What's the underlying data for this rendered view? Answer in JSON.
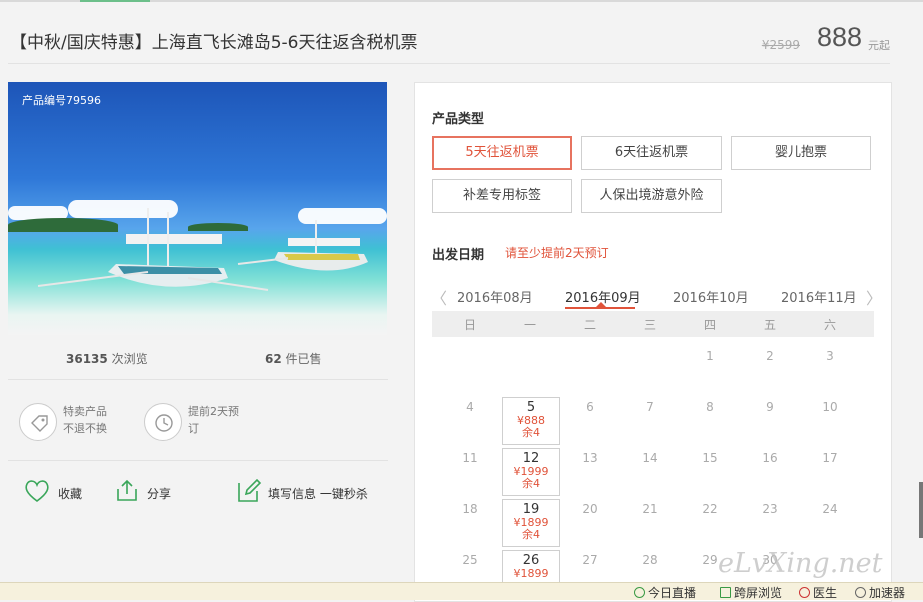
{
  "header": {
    "title": "【中秋/国庆特惠】上海直飞长滩岛5-6天往返含税机票",
    "old_price": "¥2599",
    "price": "888",
    "price_unit": "元起"
  },
  "gallery": {
    "product_id": "产品编号79596"
  },
  "stats": {
    "views_count": "36135",
    "views_label": "次浏览",
    "sold_count": "62",
    "sold_label": "件已售"
  },
  "features": [
    {
      "icon": "tag-icon",
      "line1": "特卖产品",
      "line2": "不退不换"
    },
    {
      "icon": "clock-icon",
      "line1": "提前2天预",
      "line2": "订"
    }
  ],
  "actions": {
    "favorite": "收藏",
    "share": "分享",
    "quick_fill": "填写信息 一键秒杀"
  },
  "booking": {
    "product_type_label": "产品类型",
    "options": [
      "5天往返机票",
      "6天往返机票",
      "婴儿抱票",
      "补差专用标签",
      "人保出境游意外险"
    ],
    "selected_option": "5天往返机票",
    "date_label": "出发日期",
    "date_note": "请至少提前2天预订",
    "months": [
      "2016年08月",
      "2016年09月",
      "2016年10月",
      "2016年11月"
    ],
    "selected_month": "2016年09月",
    "prev_arrow": "〈",
    "next_arrow": "〉",
    "weekdays": [
      "日",
      "一",
      "二",
      "三",
      "四",
      "五",
      "六"
    ],
    "days": {
      "d1": "1",
      "d2": "2",
      "d3": "3",
      "d4": "4",
      "d6": "6",
      "d7": "7",
      "d8": "8",
      "d9": "9",
      "d10": "10",
      "d11": "11",
      "d13": "13",
      "d14": "14",
      "d15": "15",
      "d16": "16",
      "d17": "17",
      "d18": "18",
      "d20": "20",
      "d21": "21",
      "d22": "22",
      "d23": "23",
      "d24": "24",
      "d25": "25",
      "d27": "27",
      "d28": "28",
      "d29": "29",
      "d30": "30"
    },
    "available": [
      {
        "day": "5",
        "price": "¥888",
        "left": "余4"
      },
      {
        "day": "12",
        "price": "¥1999",
        "left": "余4"
      },
      {
        "day": "19",
        "price": "¥1899",
        "left": "余4"
      },
      {
        "day": "26",
        "price": "¥1899",
        "left": ""
      }
    ]
  },
  "bottom_bar": {
    "live": "今日直播",
    "split_view": "跨屏浏览",
    "doctor": "医生",
    "accelerator": "加速器"
  },
  "watermark": "eLvXing.net",
  "colors": {
    "accent_red": "#e0533a",
    "accent_green": "#3aa65a"
  }
}
